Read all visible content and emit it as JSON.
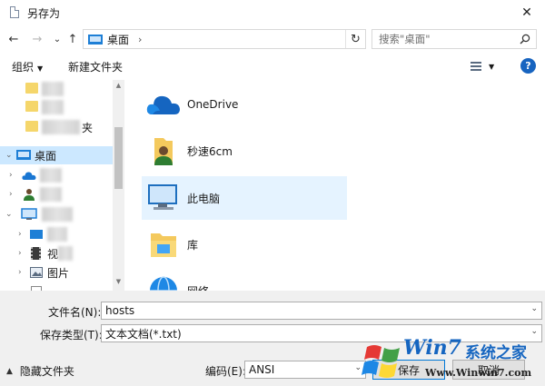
{
  "window": {
    "title": "另存为",
    "close_glyph": "✕"
  },
  "nav": {
    "back_glyph": "←",
    "forward_glyph": "→",
    "history_glyph": "⌄",
    "up_glyph": "↑",
    "address_text": "桌面",
    "address_chevron": "›",
    "refresh_glyph": "↻",
    "search_placeholder": "搜索\"桌面\""
  },
  "toolbar": {
    "organize_label": "组织",
    "organize_caret": "▼",
    "new_folder_label": "新建文件夹",
    "view_caret": "▼",
    "help_glyph": "?"
  },
  "tree": {
    "desktop_label": "桌面",
    "folder_suffix": "夹",
    "videos_label": "视",
    "pictures_label": "图片",
    "expanded_glyph": "⌄",
    "collapsed_glyph": "›"
  },
  "items": [
    {
      "label": "OneDrive",
      "icon": "cloud-icon"
    },
    {
      "label": "秒速6cm",
      "icon": "user-folder-icon"
    },
    {
      "label": "此电脑",
      "icon": "computer-icon"
    },
    {
      "label": "库",
      "icon": "library-icon"
    },
    {
      "label": "网络",
      "icon": "network-icon"
    }
  ],
  "form": {
    "filename_label": "文件名(N):",
    "filename_value": "hosts",
    "filetype_label": "保存类型(T):",
    "filetype_value": "文本文档(*.txt)",
    "encoding_label": "编码(E):",
    "encoding_value": "ANSI",
    "dropdown_glyph": "⌄",
    "save_label": "保存",
    "cancel_label": "取消",
    "hide_folders_label": "隐藏文件夹",
    "hide_caret": "▲"
  },
  "watermark": {
    "text_cn": "系统之家",
    "url": "Www.Winwin7.com"
  },
  "colors": {
    "accent": "#0078d7",
    "selection": "#cce8ff",
    "hover": "#e5f3ff",
    "chrome": "#f0f0f0"
  }
}
